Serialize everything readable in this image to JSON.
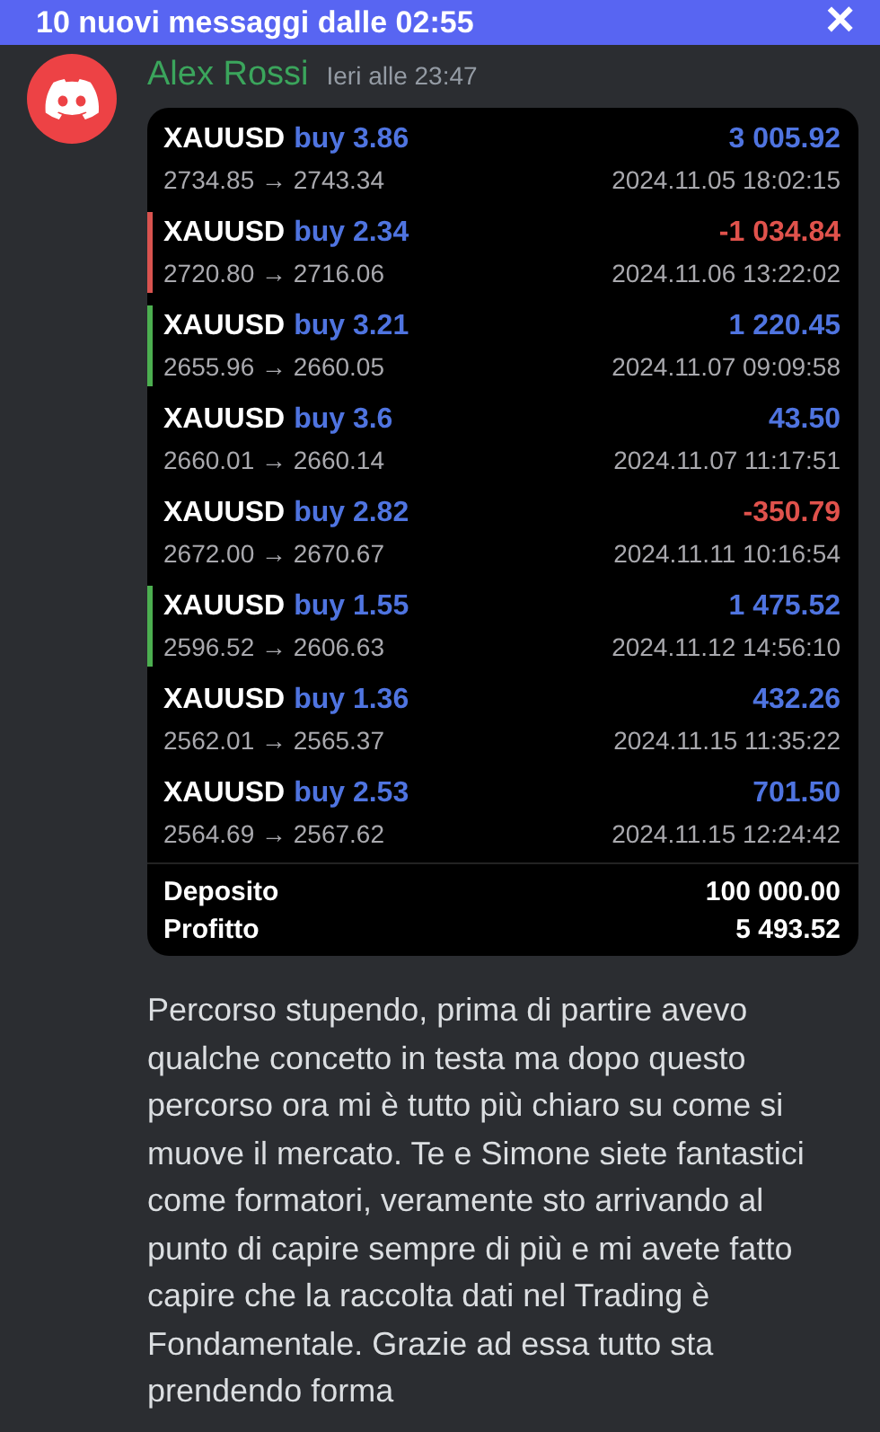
{
  "banner": {
    "text": "10 nuovi messaggi dalle 02:55",
    "close": "×"
  },
  "message": {
    "author": "Alex Rossi",
    "time": "Ieri alle 23:47",
    "trades": [
      {
        "symbol": "XAUUSD",
        "order": "buy 3.86",
        "prices": "2734.85 → 2743.34",
        "profit": "3 005.92",
        "kind": "gain",
        "date": "2024.11.05 18:02:15"
      },
      {
        "symbol": "XAUUSD",
        "order": "buy 2.34",
        "prices": "2720.80 → 2716.06",
        "profit": "-1 034.84",
        "kind": "loss",
        "color": "#d9534f",
        "date": "2024.11.06 13:22:02"
      },
      {
        "symbol": "XAUUSD",
        "order": "buy 3.21",
        "prices": "2655.96 → 2660.05",
        "profit": "1 220.45",
        "kind": "gain",
        "color": "#4caf50",
        "date": "2024.11.07 09:09:58"
      },
      {
        "symbol": "XAUUSD",
        "order": "buy 3.6",
        "prices": "2660.01 → 2660.14",
        "profit": "43.50",
        "kind": "gain",
        "date": "2024.11.07 11:17:51"
      },
      {
        "symbol": "XAUUSD",
        "order": "buy 2.82",
        "prices": "2672.00 → 2670.67",
        "profit": "-350.79",
        "kind": "loss",
        "date": "2024.11.11 10:16:54"
      },
      {
        "symbol": "XAUUSD",
        "order": "buy 1.55",
        "prices": "2596.52 → 2606.63",
        "profit": "1 475.52",
        "kind": "gain",
        "color": "#4caf50",
        "date": "2024.11.12 14:56:10"
      },
      {
        "symbol": "XAUUSD",
        "order": "buy 1.36",
        "prices": "2562.01 → 2565.37",
        "profit": "432.26",
        "kind": "gain",
        "date": "2024.11.15 11:35:22"
      },
      {
        "symbol": "XAUUSD",
        "order": "buy 2.53",
        "prices": "2564.69 → 2567.62",
        "profit": "701.50",
        "kind": "gain",
        "date": "2024.11.15 12:24:42"
      }
    ],
    "summary": [
      {
        "label": "Deposito",
        "value": "100 000.00"
      },
      {
        "label": "Profitto",
        "value": "5 493.52"
      }
    ],
    "text": "Percorso stupendo, prima di partire avevo qualche concetto in testa ma dopo questo percorso ora mi è tutto più chiaro su come si muove il mercato. Te e Simone siete fantastici come formatori, veramente sto arrivando al punto di capire sempre di più e mi avete fatto capire che la raccolta dati nel Trading è Fondamentale. Grazie ad essa tutto sta prendendo forma"
  }
}
